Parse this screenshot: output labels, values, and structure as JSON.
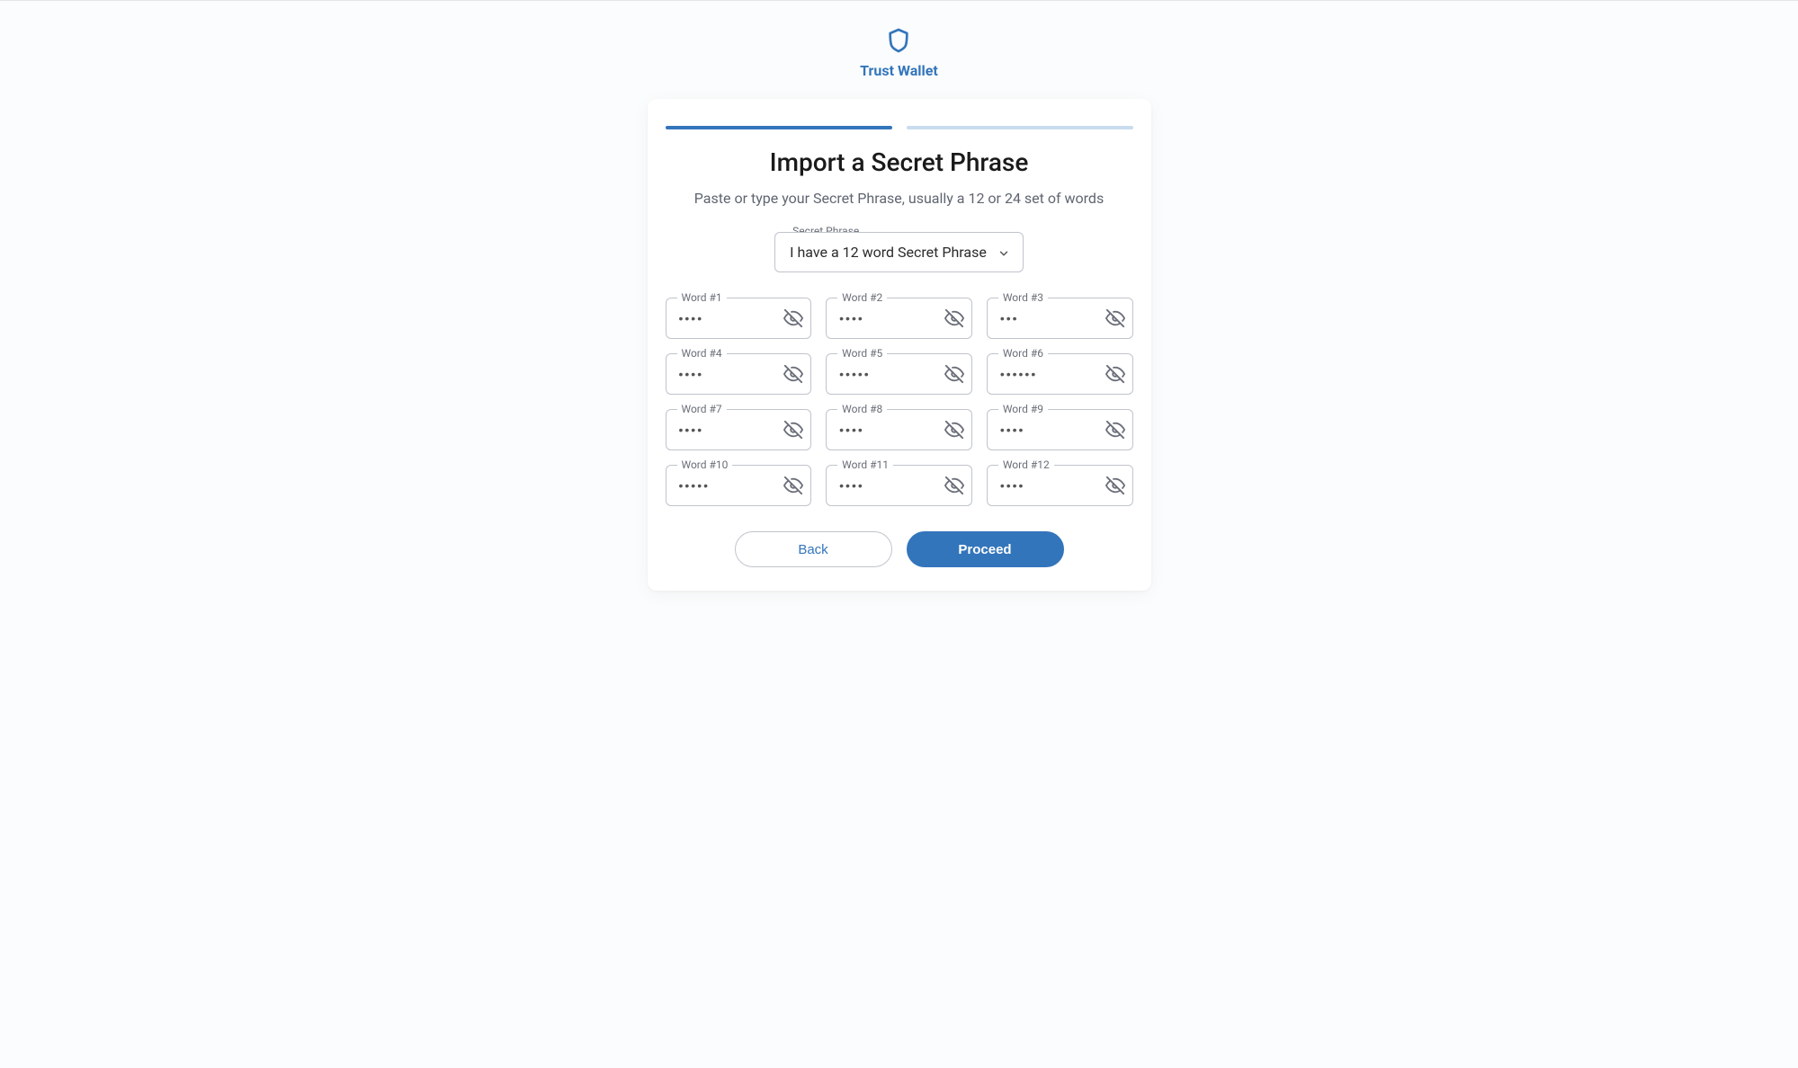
{
  "brand": {
    "name": "Trust Wallet"
  },
  "page": {
    "title": "Import a Secret Phrase",
    "subtitle": "Paste or type your Secret Phrase, usually a 12 or 24 set of words"
  },
  "phrase_select": {
    "legend": "Secret Phrase",
    "selected": "I have a 12 word Secret Phrase"
  },
  "words": [
    {
      "label": "Word #1",
      "masked": "••••"
    },
    {
      "label": "Word #2",
      "masked": "••••"
    },
    {
      "label": "Word #3",
      "masked": "•••"
    },
    {
      "label": "Word #4",
      "masked": "••••"
    },
    {
      "label": "Word #5",
      "masked": "•••••"
    },
    {
      "label": "Word #6",
      "masked": "••••••"
    },
    {
      "label": "Word #7",
      "masked": "••••"
    },
    {
      "label": "Word #8",
      "masked": "••••"
    },
    {
      "label": "Word #9",
      "masked": "••••"
    },
    {
      "label": "Word #10",
      "masked": "•••••"
    },
    {
      "label": "Word #11",
      "masked": "••••"
    },
    {
      "label": "Word #12",
      "masked": "••••"
    }
  ],
  "actions": {
    "back": "Back",
    "proceed": "Proceed"
  },
  "progress": {
    "step": 1,
    "total": 2
  }
}
